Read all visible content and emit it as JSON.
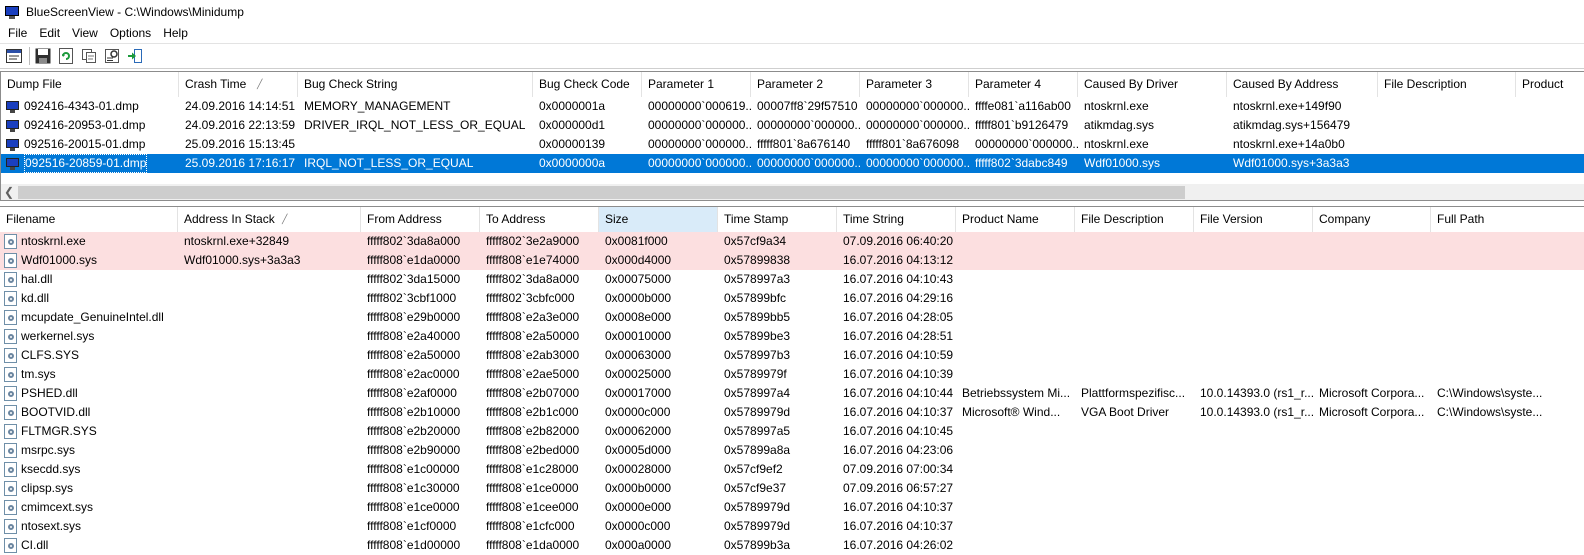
{
  "window": {
    "title": "BlueScreenView   -   C:\\Windows\\Minidump"
  },
  "menu": [
    "File",
    "Edit",
    "View",
    "Options",
    "Help"
  ],
  "toolbar": [
    "properties-icon",
    "save-icon",
    "refresh-icon",
    "copy-icon",
    "advanced-options-icon",
    "exit-icon"
  ],
  "top_table": {
    "sort_column_index": 1,
    "columns": [
      {
        "label": "Dump File"
      },
      {
        "label": "Crash Time"
      },
      {
        "label": "Bug Check String"
      },
      {
        "label": "Bug Check Code"
      },
      {
        "label": "Parameter 1"
      },
      {
        "label": "Parameter 2"
      },
      {
        "label": "Parameter 3"
      },
      {
        "label": "Parameter 4"
      },
      {
        "label": "Caused By Driver"
      },
      {
        "label": "Caused By Address"
      },
      {
        "label": "File Description"
      },
      {
        "label": "Product"
      }
    ],
    "rows": [
      {
        "state": "normal",
        "cells": [
          "092416-4343-01.dmp",
          "24.09.2016 14:14:51",
          "MEMORY_MANAGEMENT",
          "0x0000001a",
          "00000000`000619...",
          "00007ff8`29f57510",
          "00000000`000000...",
          "ffffe081`a116ab00",
          "ntoskrnl.exe",
          "ntoskrnl.exe+149f90",
          "",
          ""
        ]
      },
      {
        "state": "normal",
        "cells": [
          "092416-20953-01.dmp",
          "24.09.2016 22:13:59",
          "DRIVER_IRQL_NOT_LESS_OR_EQUAL",
          "0x000000d1",
          "00000000`000000...",
          "00000000`000000...",
          "00000000`000000...",
          "fffff801`b9126479",
          "atikmdag.sys",
          "atikmdag.sys+156479",
          "",
          ""
        ]
      },
      {
        "state": "normal",
        "cells": [
          "092516-20015-01.dmp",
          "25.09.2016 15:13:45",
          "",
          "0x00000139",
          "00000000`000000...",
          "fffff801`8a676140",
          "fffff801`8a676098",
          "00000000`000000...",
          "ntoskrnl.exe",
          "ntoskrnl.exe+14a0b0",
          "",
          ""
        ]
      },
      {
        "state": "selected",
        "cells": [
          "092516-20859-01.dmp",
          "25.09.2016 17:16:17",
          "IRQL_NOT_LESS_OR_EQUAL",
          "0x0000000a",
          "00000000`000000...",
          "00000000`000000...",
          "00000000`000000...",
          "fffff802`3dabc849",
          "Wdf01000.sys",
          "Wdf01000.sys+3a3a3",
          "",
          ""
        ]
      }
    ]
  },
  "bottom_table": {
    "sort_column_index": 1,
    "highlighted_column_index": 4,
    "columns": [
      {
        "label": "Filename"
      },
      {
        "label": "Address In Stack"
      },
      {
        "label": "From Address"
      },
      {
        "label": "To Address"
      },
      {
        "label": "Size"
      },
      {
        "label": "Time Stamp"
      },
      {
        "label": "Time String"
      },
      {
        "label": "Product Name"
      },
      {
        "label": "File Description"
      },
      {
        "label": "File Version"
      },
      {
        "label": "Company"
      },
      {
        "label": "Full Path"
      }
    ],
    "rows": [
      {
        "state": "highlight",
        "cells": [
          "ntoskrnl.exe",
          "ntoskrnl.exe+32849",
          "fffff802`3da8a000",
          "fffff802`3e2a9000",
          "0x0081f000",
          "0x57cf9a34",
          "07.09.2016 06:40:20",
          "",
          "",
          "",
          "",
          ""
        ]
      },
      {
        "state": "highlight",
        "cells": [
          "Wdf01000.sys",
          "Wdf01000.sys+3a3a3",
          "fffff808`e1da0000",
          "fffff808`e1e74000",
          "0x000d4000",
          "0x57899838",
          "16.07.2016 04:13:12",
          "",
          "",
          "",
          "",
          ""
        ]
      },
      {
        "state": "normal",
        "cells": [
          "hal.dll",
          "",
          "fffff802`3da15000",
          "fffff802`3da8a000",
          "0x00075000",
          "0x578997a3",
          "16.07.2016 04:10:43",
          "",
          "",
          "",
          "",
          ""
        ]
      },
      {
        "state": "normal",
        "cells": [
          "kd.dll",
          "",
          "fffff802`3cbf1000",
          "fffff802`3cbfc000",
          "0x0000b000",
          "0x57899bfc",
          "16.07.2016 04:29:16",
          "",
          "",
          "",
          "",
          ""
        ]
      },
      {
        "state": "normal",
        "cells": [
          "mcupdate_GenuineIntel.dll",
          "",
          "fffff808`e29b0000",
          "fffff808`e2a3e000",
          "0x0008e000",
          "0x57899bb5",
          "16.07.2016 04:28:05",
          "",
          "",
          "",
          "",
          ""
        ]
      },
      {
        "state": "normal",
        "cells": [
          "werkernel.sys",
          "",
          "fffff808`e2a40000",
          "fffff808`e2a50000",
          "0x00010000",
          "0x57899be3",
          "16.07.2016 04:28:51",
          "",
          "",
          "",
          "",
          ""
        ]
      },
      {
        "state": "normal",
        "cells": [
          "CLFS.SYS",
          "",
          "fffff808`e2a50000",
          "fffff808`e2ab3000",
          "0x00063000",
          "0x578997b3",
          "16.07.2016 04:10:59",
          "",
          "",
          "",
          "",
          ""
        ]
      },
      {
        "state": "normal",
        "cells": [
          "tm.sys",
          "",
          "fffff808`e2ac0000",
          "fffff808`e2ae5000",
          "0x00025000",
          "0x5789979f",
          "16.07.2016 04:10:39",
          "",
          "",
          "",
          "",
          ""
        ]
      },
      {
        "state": "normal",
        "cells": [
          "PSHED.dll",
          "",
          "fffff808`e2af0000",
          "fffff808`e2b07000",
          "0x00017000",
          "0x578997a4",
          "16.07.2016 04:10:44",
          "Betriebssystem Mi...",
          "Plattformspezifisc...",
          "10.0.14393.0 (rs1_r...",
          "Microsoft Corpora...",
          "C:\\Windows\\syste..."
        ]
      },
      {
        "state": "normal",
        "cells": [
          "BOOTVID.dll",
          "",
          "fffff808`e2b10000",
          "fffff808`e2b1c000",
          "0x0000c000",
          "0x5789979d",
          "16.07.2016 04:10:37",
          "Microsoft® Wind...",
          "VGA Boot Driver",
          "10.0.14393.0 (rs1_r...",
          "Microsoft Corpora...",
          "C:\\Windows\\syste..."
        ]
      },
      {
        "state": "normal",
        "cells": [
          "FLTMGR.SYS",
          "",
          "fffff808`e2b20000",
          "fffff808`e2b82000",
          "0x00062000",
          "0x578997a5",
          "16.07.2016 04:10:45",
          "",
          "",
          "",
          "",
          ""
        ]
      },
      {
        "state": "normal",
        "cells": [
          "msrpc.sys",
          "",
          "fffff808`e2b90000",
          "fffff808`e2bed000",
          "0x0005d000",
          "0x57899a8a",
          "16.07.2016 04:23:06",
          "",
          "",
          "",
          "",
          ""
        ]
      },
      {
        "state": "normal",
        "cells": [
          "ksecdd.sys",
          "",
          "fffff808`e1c00000",
          "fffff808`e1c28000",
          "0x00028000",
          "0x57cf9ef2",
          "07.09.2016 07:00:34",
          "",
          "",
          "",
          "",
          ""
        ]
      },
      {
        "state": "normal",
        "cells": [
          "clipsp.sys",
          "",
          "fffff808`e1c30000",
          "fffff808`e1ce0000",
          "0x000b0000",
          "0x57cf9e37",
          "07.09.2016 06:57:27",
          "",
          "",
          "",
          "",
          ""
        ]
      },
      {
        "state": "normal",
        "cells": [
          "cmimcext.sys",
          "",
          "fffff808`e1ce0000",
          "fffff808`e1cee000",
          "0x0000e000",
          "0x5789979d",
          "16.07.2016 04:10:37",
          "",
          "",
          "",
          "",
          ""
        ]
      },
      {
        "state": "normal",
        "cells": [
          "ntosext.sys",
          "",
          "fffff808`e1cf0000",
          "fffff808`e1cfc000",
          "0x0000c000",
          "0x5789979d",
          "16.07.2016 04:10:37",
          "",
          "",
          "",
          "",
          ""
        ]
      },
      {
        "state": "normal",
        "cells": [
          "CI.dll",
          "",
          "fffff808`e1d00000",
          "fffff808`e1da0000",
          "0x000a0000",
          "0x57899b3a",
          "16.07.2016 04:26:02",
          "",
          "",
          "",
          "",
          ""
        ]
      }
    ]
  }
}
